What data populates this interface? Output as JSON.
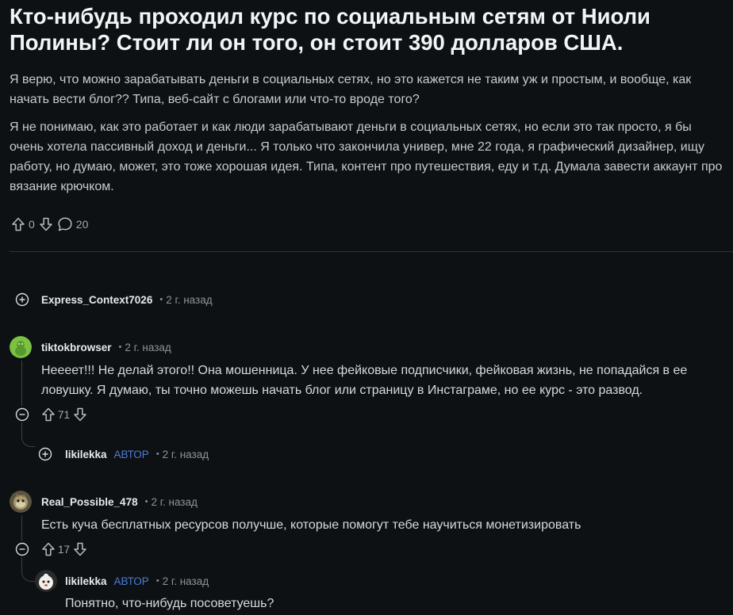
{
  "post": {
    "title": "Кто-нибудь проходил курс по социальным сетям от Ниоли Полины? Стоит ли он того, он стоит 390 долларов США.",
    "body": [
      "Я верю, что можно зарабатывать деньги в социальных сетях, но это кажется не таким уж и простым, и вообще, как начать вести блог?? Типа, веб-сайт с блогами или что-то вроде того?",
      "Я не понимаю, как это работает и как люди зарабатывают деньги в социальных сетях, но если это так просто, я бы очень хотела пассивный доход и деньги... Я только что закончила универ, мне 22 года, я графический дизайнер, ищу работу, но думаю, может, это тоже хорошая идея. Типа, контент про путешествия, еду и т.д. Думала завести аккаунт про вязание крючком."
    ],
    "score": "0",
    "comment_count": "20"
  },
  "comments": [
    {
      "author": "Express_Context7026",
      "time": "2 г. назад",
      "collapsed": true
    },
    {
      "author": "tiktokbrowser",
      "time": "2 г. назад",
      "text": "Неееет!!! Не делай этого!! Она мошенница. У нее фейковые подписчики, фейковая жизнь, не попадайся в ее ловушку. Я думаю, ты точно можешь начать блог или страницу в Инстаграме, но ее курс - это развод.",
      "score": "71",
      "avatar_color": "#7cc242"
    },
    {
      "author": "likilekka",
      "op_label": "АВТОР",
      "time": "2 г. назад",
      "collapsed": true
    },
    {
      "author": "Real_Possible_478",
      "time": "2 г. назад",
      "text": "Есть куча бесплатных ресурсов получше, которые помогут тебе научиться монетизировать",
      "score": "17"
    },
    {
      "author": "likilekka",
      "op_label": "АВТОР",
      "time": "2 г. назад",
      "text": "Понятно, что-нибудь посоветуешь?"
    }
  ],
  "separator": "•",
  "icons": {
    "upvote": "arrow-up-icon",
    "downvote": "arrow-down-icon",
    "comment": "speech-bubble-icon",
    "expand": "plus-circle-icon",
    "collapse": "minus-circle-icon"
  }
}
